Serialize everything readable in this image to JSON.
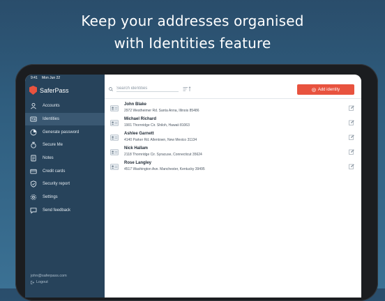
{
  "headline": {
    "line1": "Keep your addresses organised",
    "line2": "with Identities feature"
  },
  "statusbar": {
    "time": "9:41",
    "date": "Mon Jun 22",
    "battery": "100%"
  },
  "app": {
    "name": "SaferPass"
  },
  "sidebar": {
    "items": [
      {
        "label": "Accounts",
        "icon": "user-icon"
      },
      {
        "label": "Identities",
        "icon": "id-card-icon",
        "active": true
      },
      {
        "label": "Generate password",
        "icon": "generate-icon"
      },
      {
        "label": "Secure Me",
        "icon": "secure-icon"
      },
      {
        "label": "Notes",
        "icon": "note-icon"
      },
      {
        "label": "Credit cards",
        "icon": "card-icon"
      },
      {
        "label": "Security report",
        "icon": "shield-icon"
      },
      {
        "label": "Settings",
        "icon": "gear-icon"
      },
      {
        "label": "Send feedback",
        "icon": "chat-icon"
      }
    ],
    "account_email": "john@saferpass.com",
    "logout_label": "Logout"
  },
  "toolbar": {
    "search_placeholder": "Search identities",
    "add_label": "Add identity"
  },
  "identities": [
    {
      "name": "John Blake",
      "address": "2972 Westheimer Rd. Santa Anna, Illinois 85486"
    },
    {
      "name": "Michael Richard",
      "address": "1901 Thornridge Cir. Shiloh, Hawaii 81063"
    },
    {
      "name": "Ashlee Garnett",
      "address": "4140 Parker Rd. Allentown, New Mexico 31134"
    },
    {
      "name": "Nick Hallam",
      "address": "2118 Thornridge Cir. Syracuse, Connecticut 35624"
    },
    {
      "name": "Rose Langley",
      "address": "4517 Washington Ave. Manchester, Kentucky 39495"
    }
  ],
  "colors": {
    "accent": "#e8533f",
    "sidebar": "#27435b",
    "sidebar_active": "#3a5872"
  }
}
